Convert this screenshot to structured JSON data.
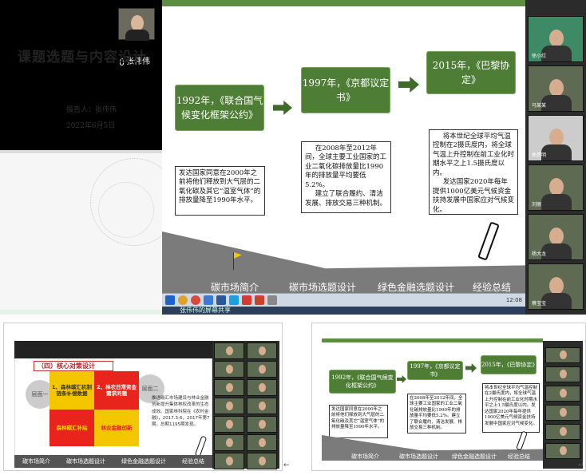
{
  "top": {
    "presenter_name": "张伟伟",
    "title_slide": {
      "title": "课题选题与内容设计",
      "reporter": "报告人：张伟伟",
      "date": "2022年6月5日"
    },
    "timeline": {
      "box1": "1992年，《联合国气候变化框架公约》",
      "box2": "1997年，《京都议定书》",
      "box3": "2015年，《巴黎协定》",
      "text1": "发达国家同意在2000年之前将他们释放到大气层的二氧化碳及其它“温室气体”的排放量降至1990年水平。",
      "text2a": "在2008年至2012年间，全球主要工业国家的工业二氧化碳排放量比1990年的排放量平均要低5.2%。",
      "text2b": "建立了联合履约、清洁发展、排放交易三种机制。",
      "text3a": "将本世纪全球平均气温控制在2摄氏度内，将全球气温上升控制在前工业化时期水平之上1.5摄氏度以内。",
      "text3b": "发达国家2020年每年提供1000亿美元气候资金扶持发展中国家应对气候变化。"
    },
    "nav": [
      "碳市场简介",
      "碳市场选题设计",
      "绿色金融选题设计",
      "经验总结"
    ],
    "share_label": "张伟伟的屏幕共享",
    "clock": "12:08",
    "participants": [
      "徐小红",
      "马某某",
      "曲贵明",
      "刘丽",
      "杨大龙",
      "蔡宝宝"
    ]
  },
  "bottom_left": {
    "section": "（四）核心对策设计",
    "layer1": "层面一",
    "layer2": "层面二",
    "cells": [
      "1、森林碳汇机制链条补偿数据",
      "2、林农日常资金需求问题",
      "森林碳汇补贴",
      "林业金融创新"
    ],
    "body": "推进碳汇市场建设与林业金融创新提升集体林权改革的生态成效。国家林科院在《农村金融》，2017.3-6，2017年第7期，总期1195期发现。",
    "nav": [
      "碳市场简介",
      "碳市场选题设计",
      "绿色金融选题设计",
      "经验总结"
    ],
    "left_caret": "←"
  },
  "bottom_right": {
    "box1": "1992年，《联合国气候变化框架公约》",
    "box2": "1997年，《京都议定书》",
    "box3": "2015年，《巴黎协定》",
    "text1": "发达国家同意在2000年之前将他们释放到大气层的二氧化碳及其它“温室气体”的排放量降至1990年水平。",
    "text2": "在2008年至2012年间，全球主要工业国家的工业二氧化碳排放量比1990年的排放量平均要低5.2%。建立了联合履约、清洁发展、排放交易三种机制。",
    "text3": "将本世纪全球平均气温控制在2摄氏度内，将全球气温上升控制在前工业化时期水平之上1.5摄氏度以内。发达国家2020年每年提供1000亿美元气候资金扶持发展中国家应对气候变化。",
    "nav": [
      "碳市场简介",
      "碳市场选题设计",
      "绿色金融选题设计",
      "经验总结"
    ],
    "caret": "↵"
  }
}
